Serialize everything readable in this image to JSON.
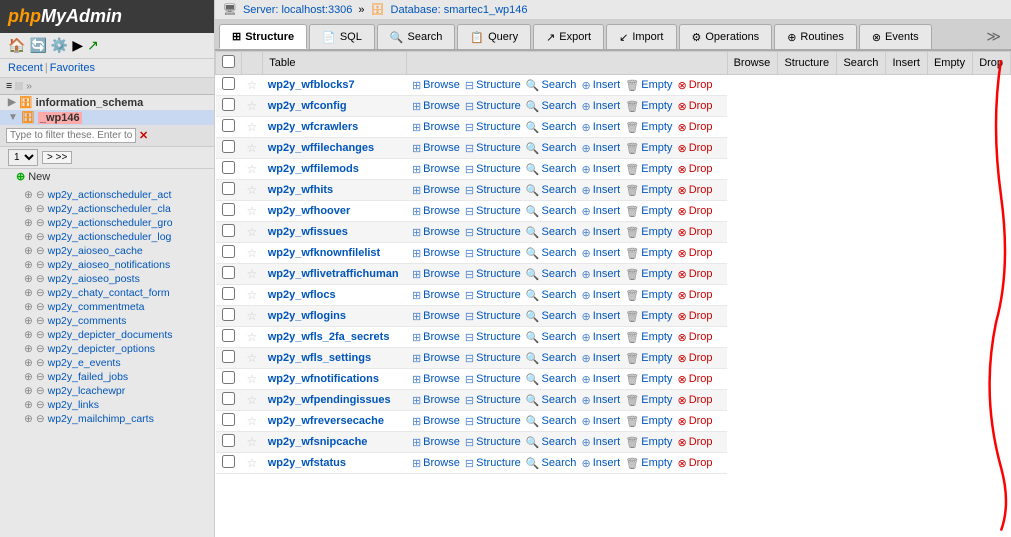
{
  "sidebar": {
    "logo_php": "php",
    "logo_myadmin": "MyAdmin",
    "recent_label": "Recent",
    "favorites_label": "Favorites",
    "filter_placeholder": "Type to filter these. Enter to search!",
    "db_info_schema": "information_schema",
    "db_wp146": "_wp146",
    "new_label": "New",
    "pagination": {
      "page": "1",
      "next": "> >>",
      "v": "▾"
    },
    "tables": [
      "wp2y_actionscheduler_act",
      "wp2y_actionscheduler_cla",
      "wp2y_actionscheduler_gro",
      "wp2y_actionscheduler_log",
      "wp2y_aioseo_cache",
      "wp2y_aioseo_notifications",
      "wp2y_aioseo_posts",
      "wp2y_chaty_contact_form",
      "wp2y_commentmeta",
      "wp2y_comments",
      "wp2y_depicter_documents",
      "wp2y_depicter_options",
      "wp2y_e_events",
      "wp2y_failed_jobs",
      "wp2y_lcachewpr",
      "wp2y_links",
      "wp2y_mailchimp_carts"
    ]
  },
  "server_bar": {
    "server_label": "Server: localhost:3306",
    "db_label": "Database: smartec1_wp146"
  },
  "tabs": [
    {
      "id": "structure",
      "label": "Structure",
      "icon": "⊞"
    },
    {
      "id": "sql",
      "label": "SQL",
      "icon": "⬜"
    },
    {
      "id": "search",
      "label": "Search",
      "icon": "🔍"
    },
    {
      "id": "query",
      "label": "Query",
      "icon": "⬜"
    },
    {
      "id": "export",
      "label": "Export",
      "icon": "↗"
    },
    {
      "id": "import",
      "label": "Import",
      "icon": "↙"
    },
    {
      "id": "operations",
      "label": "Operations",
      "icon": "⚙"
    },
    {
      "id": "routines",
      "label": "Routines",
      "icon": "⊕"
    },
    {
      "id": "events",
      "label": "Events",
      "icon": "⊗"
    }
  ],
  "table_headers": [
    "",
    "",
    "Table",
    "",
    "Browse",
    "Structure",
    "Search",
    "Insert",
    "Empty",
    "Drop"
  ],
  "rows": [
    {
      "name": "wp2y_wfblocks7"
    },
    {
      "name": "wp2y_wfconfig"
    },
    {
      "name": "wp2y_wfcrawlers"
    },
    {
      "name": "wp2y_wffilechanges"
    },
    {
      "name": "wp2y_wffilemods"
    },
    {
      "name": "wp2y_wfhits"
    },
    {
      "name": "wp2y_wfhoover"
    },
    {
      "name": "wp2y_wfissues"
    },
    {
      "name": "wp2y_wfknownfilelist"
    },
    {
      "name": "wp2y_wflivetraffichuman"
    },
    {
      "name": "wp2y_wflocs"
    },
    {
      "name": "wp2y_wflogins"
    },
    {
      "name": "wp2y_wfls_2fa_secrets"
    },
    {
      "name": "wp2y_wfls_settings"
    },
    {
      "name": "wp2y_wfnotifications"
    },
    {
      "name": "wp2y_wfpendingissues"
    },
    {
      "name": "wp2y_wfreversecache"
    },
    {
      "name": "wp2y_wfsnipcache"
    },
    {
      "name": "wp2y_wfstatus"
    }
  ],
  "action_labels": {
    "browse": "Browse",
    "structure": "Structure",
    "search": "Search",
    "insert": "Insert",
    "empty": "Empty",
    "drop": "Drop"
  },
  "colors": {
    "accent": "#0055bb",
    "drop": "#cc0000",
    "red_line": "red"
  }
}
